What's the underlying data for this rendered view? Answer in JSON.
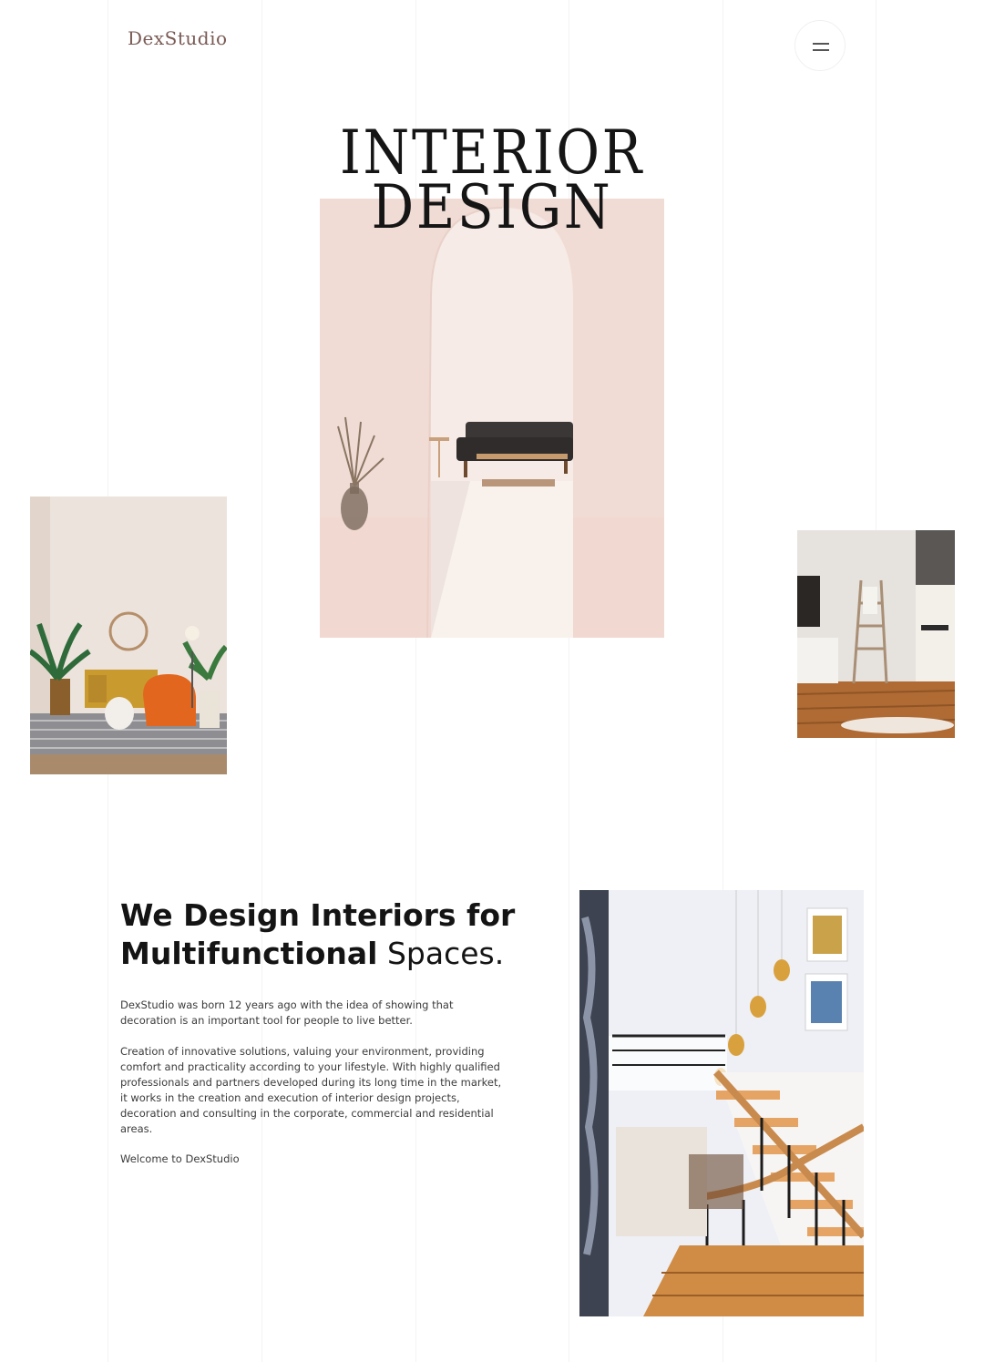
{
  "header": {
    "logo_text": "DexStudio",
    "menu_icon": "hamburger-menu-icon"
  },
  "hero": {
    "title_line1": "INTERIOR",
    "title_line2": "DESIGN"
  },
  "about": {
    "headline_bold_1": "We Design Interiors for",
    "headline_bold_2": "Multifunctional",
    "headline_light": "Spaces.",
    "paragraph_1": "DexStudio was born 12 years ago with the idea of showing that decoration is an important tool for people to live better.",
    "paragraph_2": "Creation of innovative solutions, valuing your environment, providing comfort and practicality according to your lifestyle. With highly qualified professionals and partners developed during its long time in the market, it works in the creation and execution of interior design projects, decoration and consulting in the corporate, commercial and residential areas.",
    "paragraph_3": "Welcome to DexStudio"
  },
  "colors": {
    "logo": "#7a5a55",
    "hero_bg": "#f1ddd6",
    "text": "#1b1b1b"
  }
}
